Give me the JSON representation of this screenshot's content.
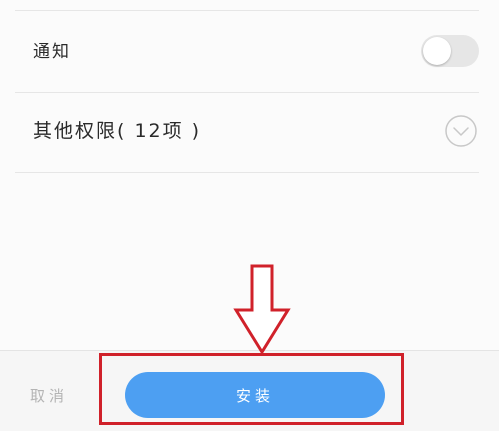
{
  "permissions": {
    "notification": {
      "label": "通知",
      "toggle_on": false
    },
    "other": {
      "label": "其他权限( 12项 )"
    }
  },
  "footer": {
    "cancel_label": "取消",
    "install_label": "安装"
  },
  "colors": {
    "install_button": "#4d9ff2",
    "annotation": "#d0212a",
    "toggle_track": "#e6e6e6"
  },
  "icons": {
    "expand": "chevron-down-circle-icon",
    "annotation_arrow": "arrow-down-outline-icon"
  }
}
